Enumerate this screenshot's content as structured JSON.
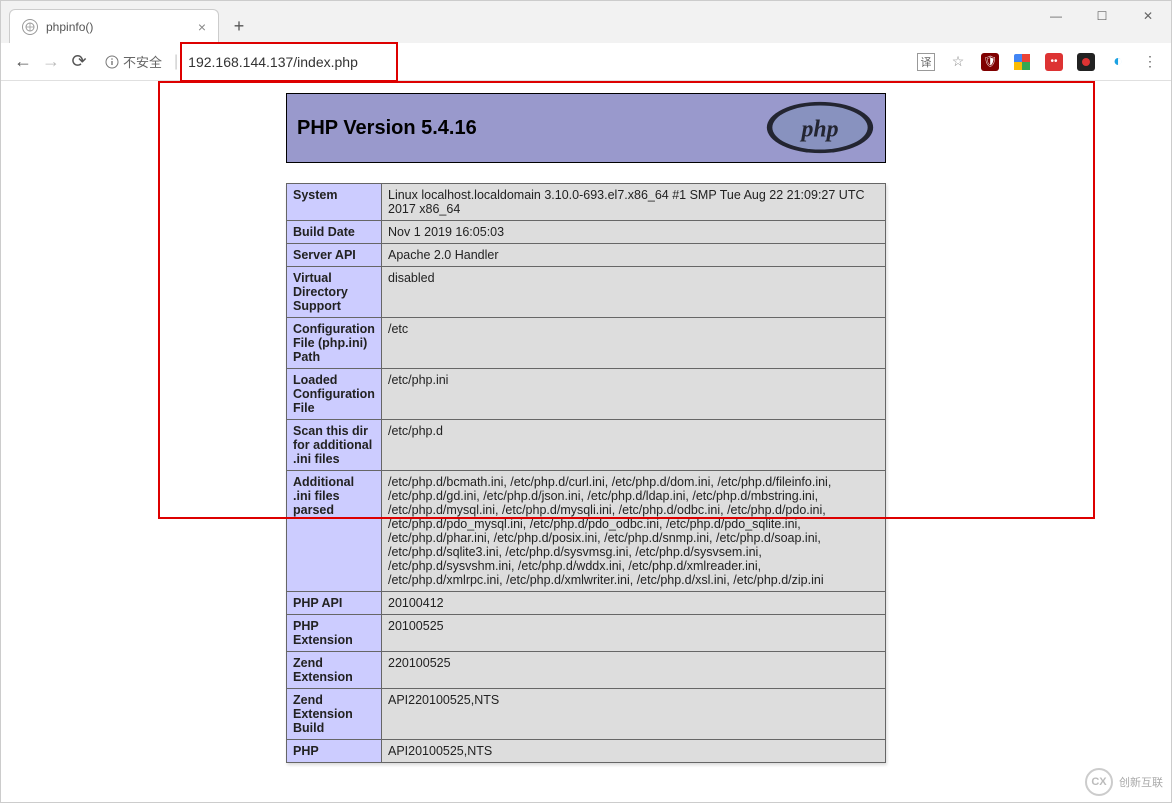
{
  "browser": {
    "tab_title": "phpinfo()",
    "url": "192.168.144.137/index.php",
    "security_label": "不安全",
    "window": {
      "min": "—",
      "max": "☐",
      "close": "✕"
    },
    "ext": {
      "translate": "译",
      "star": "☆",
      "ublock": "🛡",
      "g": "G",
      "mask": "👓",
      "cam": "◉",
      "globe": "◐",
      "menu": "⋮"
    }
  },
  "page": {
    "title": "PHP Version 5.4.16",
    "rows": [
      {
        "k": "System",
        "v": "Linux localhost.localdomain 3.10.0-693.el7.x86_64 #1 SMP Tue Aug 22 21:09:27 UTC 2017 x86_64"
      },
      {
        "k": "Build Date",
        "v": "Nov 1 2019 16:05:03"
      },
      {
        "k": "Server API",
        "v": "Apache 2.0 Handler"
      },
      {
        "k": "Virtual Directory Support",
        "v": "disabled"
      },
      {
        "k": "Configuration File (php.ini) Path",
        "v": "/etc"
      },
      {
        "k": "Loaded Configuration File",
        "v": "/etc/php.ini"
      },
      {
        "k": "Scan this dir for additional .ini files",
        "v": "/etc/php.d"
      },
      {
        "k": "Additional .ini files parsed",
        "v": "/etc/php.d/bcmath.ini, /etc/php.d/curl.ini, /etc/php.d/dom.ini, /etc/php.d/fileinfo.ini, /etc/php.d/gd.ini, /etc/php.d/json.ini, /etc/php.d/ldap.ini, /etc/php.d/mbstring.ini, /etc/php.d/mysql.ini, /etc/php.d/mysqli.ini, /etc/php.d/odbc.ini, /etc/php.d/pdo.ini, /etc/php.d/pdo_mysql.ini, /etc/php.d/pdo_odbc.ini, /etc/php.d/pdo_sqlite.ini, /etc/php.d/phar.ini, /etc/php.d/posix.ini, /etc/php.d/snmp.ini, /etc/php.d/soap.ini, /etc/php.d/sqlite3.ini, /etc/php.d/sysvmsg.ini, /etc/php.d/sysvsem.ini, /etc/php.d/sysvshm.ini, /etc/php.d/wddx.ini, /etc/php.d/xmlreader.ini, /etc/php.d/xmlrpc.ini, /etc/php.d/xmlwriter.ini, /etc/php.d/xsl.ini, /etc/php.d/zip.ini"
      },
      {
        "k": "PHP API",
        "v": "20100412"
      },
      {
        "k": "PHP Extension",
        "v": "20100525"
      },
      {
        "k": "Zend Extension",
        "v": "220100525"
      },
      {
        "k": "Zend Extension Build",
        "v": "API220100525,NTS"
      },
      {
        "k": "PHP",
        "v": "API20100525,NTS"
      }
    ]
  },
  "watermark": "创新互联"
}
